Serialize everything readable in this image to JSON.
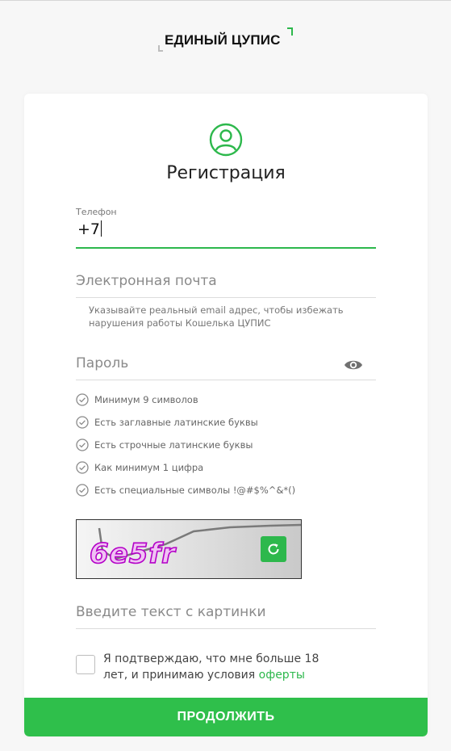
{
  "logo": {
    "text": "ЕДИНЫЙ ЦУПИС"
  },
  "form": {
    "title": "Регистрация",
    "phone": {
      "label": "Телефон",
      "value": "+7"
    },
    "email": {
      "placeholder": "Электронная почта",
      "hint": "Указывайте реальный email адрес, чтобы избежать нарушения работы Кошелька ЦУПИС"
    },
    "password": {
      "placeholder": "Пароль"
    },
    "requirements": [
      "Минимум 9 символов",
      "Есть заглавные латинские буквы",
      "Есть строчные латинские буквы",
      "Как минимум 1 цифра",
      "Есть специальные символы !@#$%^&*()"
    ],
    "captcha": {
      "text": "6e5fr",
      "input_placeholder": "Введите текст с картинки"
    },
    "consent": {
      "text": "Я подтверждаю, что мне больше 18 лет, и принимаю условия ",
      "link": "оферты"
    },
    "submit_label": "ПРОДОЛЖИТЬ"
  },
  "icons": {
    "user": "user-circle-icon",
    "eye": "eye-icon",
    "check": "check-circle-icon",
    "refresh": "refresh-icon"
  },
  "colors": {
    "accent": "#2db84c",
    "button": "#2fbf4b",
    "captcha_text": "#b400c8"
  }
}
